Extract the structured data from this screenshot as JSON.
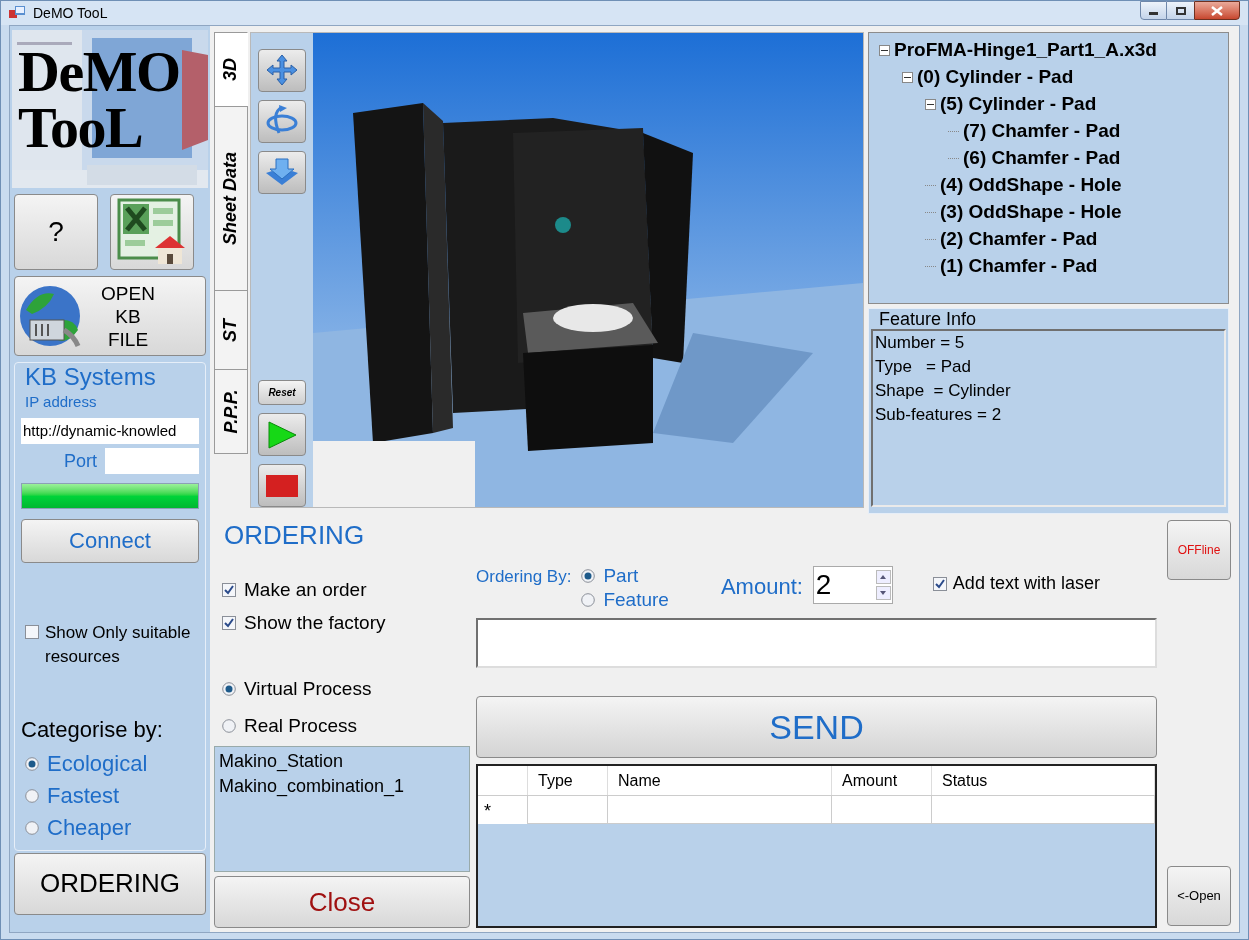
{
  "window": {
    "title": "DeMO TooL"
  },
  "logo": {
    "lines": [
      "DeMO",
      "TooL"
    ]
  },
  "help_button": {
    "label": "?"
  },
  "open_kb_button": {
    "lines": [
      "OPEN",
      "KB",
      "FILE"
    ]
  },
  "kb_systems": {
    "title": "KB Systems",
    "ip_label": "IP address",
    "ip_value": "http://dynamic-knowled",
    "port_label": "Port",
    "progress": {
      "level": 1
    },
    "connect_button": "Connect",
    "show_only": {
      "label": "Show Only suitable resources",
      "checked": false
    },
    "categorise_label": "Categorise by:",
    "categories": [
      {
        "label": "Ecological",
        "selected": true
      },
      {
        "label": "Fastest",
        "selected": false
      },
      {
        "label": "Cheaper",
        "selected": false
      }
    ]
  },
  "ordering_button": "ORDERING",
  "view_tabs": [
    {
      "label": "3D",
      "selected": true
    },
    {
      "label": "Sheet Data",
      "selected": false
    },
    {
      "label": "ST",
      "selected": false
    },
    {
      "label": "P.P.P.",
      "selected": false
    }
  ],
  "viewer_tools": {
    "reset_label": "Reset"
  },
  "tree": [
    {
      "label": "ProFMA-Hinge1_Part1_A.x3d",
      "expanded": true,
      "children": [
        {
          "label": "(0) Cylinder - Pad",
          "expanded": true,
          "children": [
            {
              "label": "(5) Cylinder - Pad",
              "expanded": true,
              "children": [
                {
                  "label": "(7) Chamfer - Pad"
                },
                {
                  "label": "(6) Chamfer - Pad"
                }
              ]
            },
            {
              "label": "(4) OddShape - Hole"
            },
            {
              "label": "(3) OddShape - Hole"
            },
            {
              "label": "(2) Chamfer - Pad"
            },
            {
              "label": "(1) Chamfer - Pad"
            }
          ]
        }
      ]
    }
  ],
  "feature_info": {
    "title": "Feature Info",
    "lines": [
      "Number = 5",
      "Type   = Pad",
      "Shape  = Cylinder",
      "Sub-features = 2"
    ]
  },
  "ordering": {
    "title": "ORDERING",
    "options": [
      {
        "label": "Make an order",
        "checked": true
      },
      {
        "label": "Show the factory",
        "checked": true
      }
    ],
    "process": [
      {
        "label": "Virtual Process",
        "selected": true
      },
      {
        "label": "Real Process",
        "selected": false
      }
    ],
    "resources": [
      "Makino_Station",
      "Makino_combination_1"
    ],
    "close_button": "Close",
    "ordering_by_label": "Ordering By:",
    "ordering_by": [
      {
        "label": "Part",
        "selected": true
      },
      {
        "label": "Feature",
        "selected": false
      }
    ],
    "amount_label": "Amount:",
    "amount_value": "2",
    "laser": {
      "label": "Add text with laser",
      "checked": true
    },
    "send_button": "SEND",
    "table": {
      "columns": [
        "Type",
        "Name",
        "Amount",
        "Status"
      ],
      "new_row_marker": "*"
    }
  },
  "offline_button": "OFFline",
  "open_button": "<-Open"
}
